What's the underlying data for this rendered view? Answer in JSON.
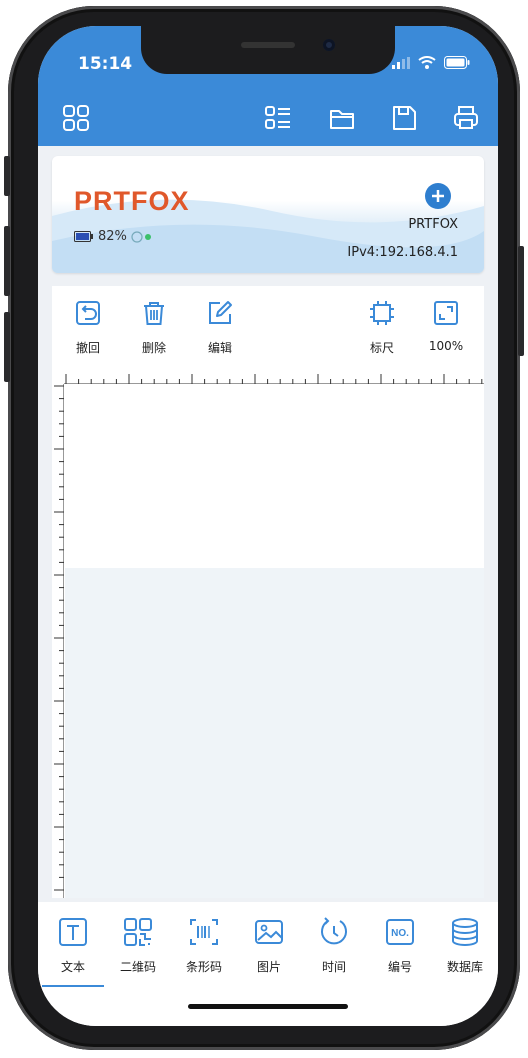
{
  "status": {
    "time": "15:14"
  },
  "device": {
    "logo": "PRTFOX",
    "battery_percent": "82%",
    "name": "PRTFOX",
    "ip": "IPv4:192.168.4.1",
    "accent_color": "#e0582b"
  },
  "edit_tools": [
    {
      "label": "撤回",
      "icon": "undo-icon"
    },
    {
      "label": "删除",
      "icon": "trash-icon"
    },
    {
      "label": "编辑",
      "icon": "edit-icon"
    },
    {
      "label": "标尺",
      "icon": "ruler-icon"
    },
    {
      "label": "100%",
      "icon": "zoom-fit-icon"
    }
  ],
  "bottom_tabs": [
    {
      "label": "文本",
      "icon": "text-icon",
      "active": true
    },
    {
      "label": "二维码",
      "icon": "qrcode-icon"
    },
    {
      "label": "条形码",
      "icon": "barcode-icon"
    },
    {
      "label": "图片",
      "icon": "image-icon"
    },
    {
      "label": "时间",
      "icon": "clock-icon"
    },
    {
      "label": "编号",
      "icon": "number-icon"
    },
    {
      "label": "数据库",
      "icon": "database-icon"
    }
  ],
  "colors": {
    "primary": "#3b8ad8",
    "background": "#eef1f5"
  }
}
